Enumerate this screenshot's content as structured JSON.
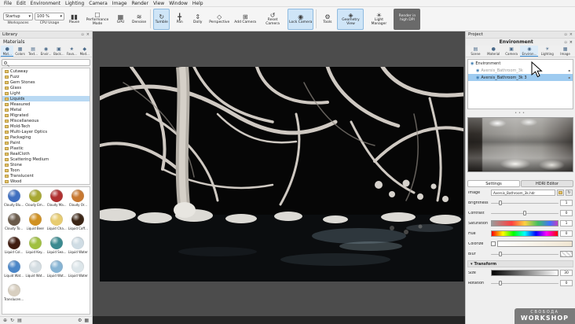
{
  "menubar": {
    "items": [
      "File",
      "Edit",
      "Environment",
      "Lighting",
      "Camera",
      "Image",
      "Render",
      "View",
      "Window",
      "Help"
    ]
  },
  "toolbar": {
    "workspaces": {
      "value": "Startup",
      "label": "Workspaces"
    },
    "cpu": {
      "value": "100 %",
      "label": "CPU Usage"
    },
    "pause": "Pause",
    "performance_mode": "Performance Mode",
    "gpu": "GPU",
    "denoise": "Denoise",
    "tumble": "Tumble",
    "pan": "Pan",
    "dolly": "Dolly",
    "perspective": "Perspective",
    "add_camera": "Add Camera",
    "reset_camera": "Reset Camera",
    "lock_camera": "Lock Camera",
    "tools": "Tools",
    "geometry_view": "Geometry View",
    "light_manager": "Light Manager",
    "render_high_dpi": "Render in high DPI"
  },
  "library": {
    "title": "Library",
    "section": "Materials",
    "tabs": [
      "Mat...",
      "Colors",
      "Text...",
      "Envir...",
      "Back...",
      "Favo...",
      "Mod..."
    ],
    "search_placeholder": "",
    "tree": [
      "Cutaway",
      "Fuzz",
      "Gem Stones",
      "Glass",
      "Light",
      "Liquids",
      "Measured",
      "Metal",
      "Migrated",
      "Miscellaneous",
      "Mold-Tech",
      "Multi-Layer Optics",
      "Packaging",
      "Paint",
      "Plastic",
      "RealCloth",
      "Scattering Medium",
      "Stone",
      "Toon",
      "Translucent",
      "Wood"
    ],
    "selected_tree_item": "Liquids",
    "materials": [
      {
        "name": "Cloudy Blu...",
        "color": "#3f6fc0"
      },
      {
        "name": "Cloudy Em...",
        "color": "#a8a832"
      },
      {
        "name": "Cloudy Ma...",
        "color": "#b03030"
      },
      {
        "name": "Cloudy Or...",
        "color": "#c87830"
      },
      {
        "name": "Cloudy To...",
        "color": "#6a5a4a"
      },
      {
        "name": "Liquid Beer",
        "color": "#d09020"
      },
      {
        "name": "Liquid Cha...",
        "color": "#e8cc70"
      },
      {
        "name": "Liquid Coff...",
        "color": "#3a2414"
      },
      {
        "name": "Liquid Col...",
        "color": "#401c10"
      },
      {
        "name": "Liquid Key...",
        "color": "#a0c040"
      },
      {
        "name": "Liquid Sea...",
        "color": "#3a8a90"
      },
      {
        "name": "Liquid Water",
        "color": "#cfdce4"
      },
      {
        "name": "Liquid Wat...",
        "color": "#4a86c8"
      },
      {
        "name": "Liquid Wat...",
        "color": "#d4dde2"
      },
      {
        "name": "Liquid Wat...",
        "color": "#86b4d4"
      },
      {
        "name": "Liquid Water",
        "color": "#dde6ea"
      },
      {
        "name": "Translucen...",
        "color": "#d8cfc0"
      }
    ]
  },
  "project": {
    "title": "Project",
    "panel_title": "Environment",
    "tabs": [
      "Scene",
      "Material",
      "Camera",
      "Environ...",
      "Lighting",
      "Image"
    ],
    "active_tab": "Environ...",
    "environment_list": [
      {
        "name": "Environment",
        "selected": false,
        "dimmed": false,
        "locked": false
      },
      {
        "name": "Aversis_Bathroom_3k",
        "selected": false,
        "dimmed": true,
        "locked": true
      },
      {
        "name": "Aversis_Bathroom_3k 3",
        "selected": true,
        "dimmed": false,
        "locked": true
      }
    ],
    "settings_tabs": [
      "Settings",
      "HDRI Editor"
    ],
    "active_settings_tab": "Settings",
    "fields": {
      "image_label": "Image",
      "image_value": "Aversis_Bathroom_3k.hdr",
      "brightness_label": "Brightness",
      "brightness_value": "1",
      "contrast_label": "Contrast",
      "contrast_value": "0",
      "saturation_label": "Saturation",
      "saturation_value": "1",
      "hue_label": "Hue",
      "hue_value": "0",
      "colorize_label": "Colorize",
      "blur_label": "Blur",
      "transform_label": "Transform",
      "size_label": "Size",
      "size_value": "30",
      "rotation_label": "Rotation",
      "rotation_value": "0"
    }
  },
  "watermark": {
    "line1": "СВОБОДА",
    "line2": "WORKSHOP"
  },
  "colors": {
    "accent": "#cfe5f7",
    "selection": "#9ecbf0",
    "viewport_bg": "#4c4c4c"
  },
  "icons": {
    "dropdown": "▾",
    "pause": "▮▮",
    "checkbox": "☐",
    "gpu": "▦",
    "denoise": "≋",
    "tumble": "↻",
    "pan": "╋",
    "dolly": "⇕",
    "perspective": "◇",
    "add_camera": "⊞",
    "reset_camera": "↺",
    "lock_camera": "◉",
    "tools": "⚙",
    "geometry": "◈",
    "light": "☀",
    "scene": "▤",
    "material": "●",
    "camera": "▣",
    "environment": "◉",
    "image": "▦",
    "close": "×",
    "undock": "▫",
    "refresh": "↻",
    "lock_small": "▪",
    "dots": "•••",
    "collapse": "▾",
    "add": "⊕",
    "list": "▤",
    "gear": "⚙",
    "star": "★",
    "diamond": "◆"
  }
}
